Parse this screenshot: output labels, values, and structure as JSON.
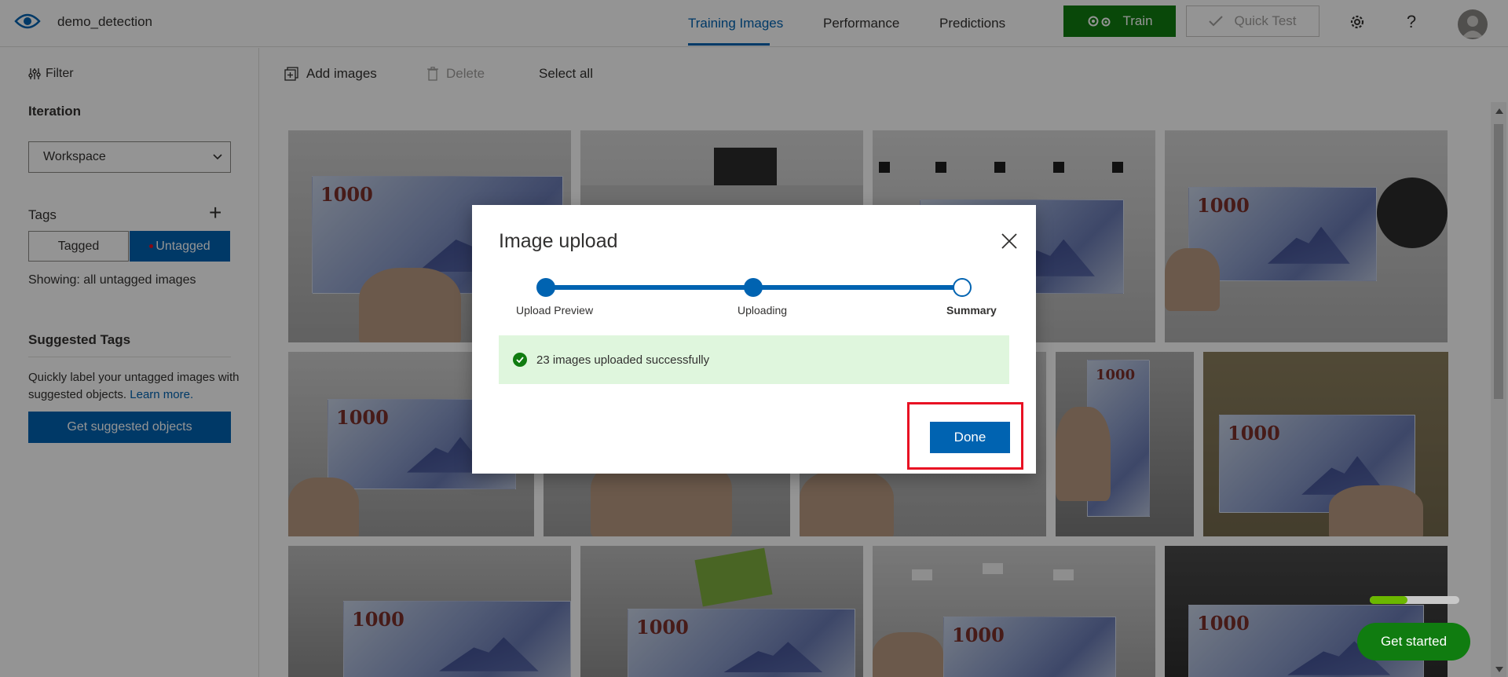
{
  "header": {
    "project_name": "demo_detection",
    "tabs": [
      {
        "label": "Training Images",
        "active": true
      },
      {
        "label": "Performance",
        "active": false
      },
      {
        "label": "Predictions",
        "active": false
      }
    ],
    "train_label": "Train",
    "quick_test_label": "Quick Test",
    "icons": [
      "eye-logo-icon",
      "gear-icon",
      "help-icon",
      "user-avatar"
    ]
  },
  "sidebar": {
    "filter_label": "Filter",
    "iteration_title": "Iteration",
    "iteration_value": "Workspace",
    "tags_title": "Tags",
    "tagged_label": "Tagged",
    "untagged_label": "Untagged",
    "showing_text": "Showing: all untagged images",
    "suggested_title": "Suggested Tags",
    "suggested_desc": "Quickly label your untagged images with suggested objects.",
    "learn_more": "Learn more.",
    "suggest_button": "Get suggested objects"
  },
  "toolbar": {
    "add_images": "Add images",
    "delete": "Delete",
    "select_all": "Select all"
  },
  "banknote_label": "1000",
  "modal": {
    "title": "Image upload",
    "steps": [
      {
        "label": "Upload Preview"
      },
      {
        "label": "Uploading"
      },
      {
        "label": "Summary",
        "current": true
      }
    ],
    "success_message": "23 images uploaded successfully",
    "done_label": "Done"
  },
  "colors": {
    "primary": "#0063b1",
    "train_green": "#107c10",
    "success_bg": "#dff6dd",
    "highlight_red": "#e81123"
  },
  "onboarding": {
    "progress_fraction": 0.42,
    "get_started_label": "Get started"
  }
}
